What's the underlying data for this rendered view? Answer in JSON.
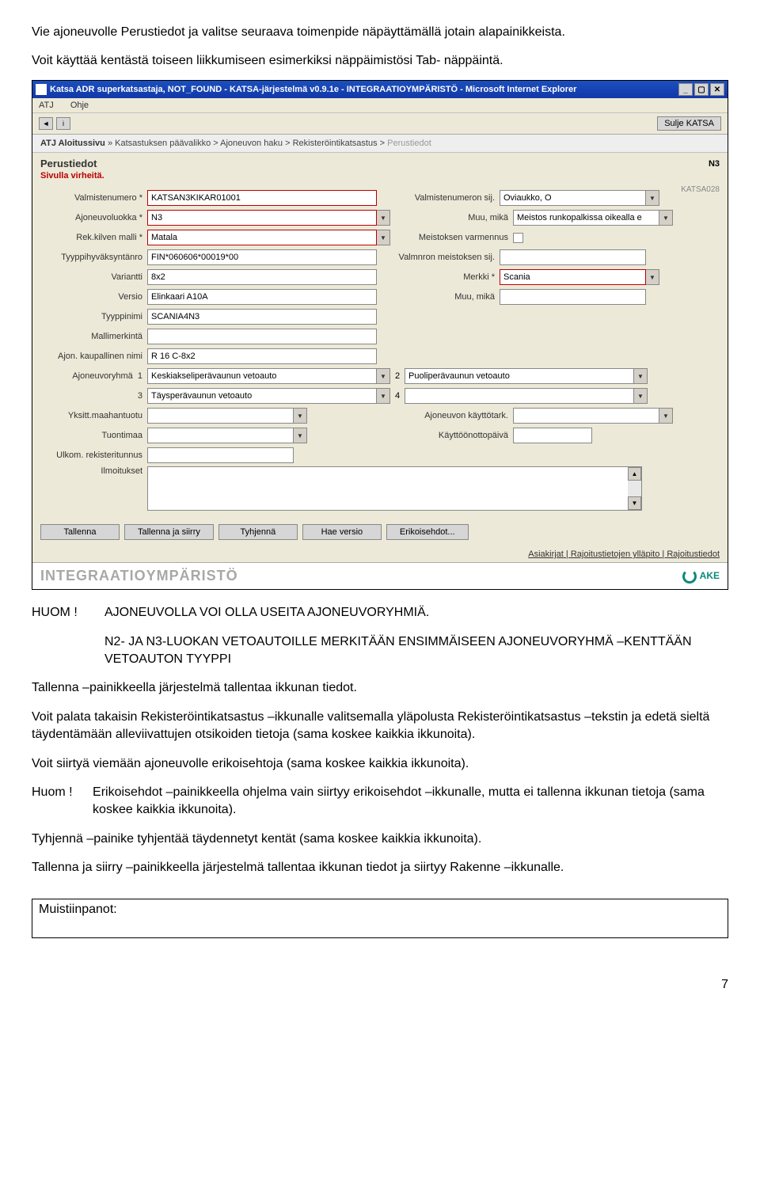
{
  "intro": {
    "p1": "Vie ajoneuvolle Perustiedot ja valitse seuraava toimenpide näpäyttämällä jotain alapainikkeista.",
    "p2": "Voit käyttää kentästä toiseen liikkumiseen esimerkiksi näppäimistösi Tab- näppäintä."
  },
  "titlebar": {
    "text": "Katsa ADR superkatsastaja, NOT_FOUND - KATSA-järjestelmä v0.9.1e - INTEGRAATIOYMPÄRISTÖ - Microsoft Internet Explorer",
    "min": "_",
    "max": "▢",
    "close": "✕"
  },
  "menubar": {
    "m1": "ATJ",
    "m2": "Ohje"
  },
  "toolbar": {
    "back": "◄",
    "fwd": "i",
    "close_katsa": "Sulje KATSA"
  },
  "breadcrumb": {
    "start": "ATJ Aloitussivu",
    "sep": " » ",
    "b1": "Katsastuksen päävalikko",
    "b2": " > Ajoneuvon haku > ",
    "b3": "Rekisteröintikatsastus",
    "b4": " > ",
    "cur": "Perustiedot"
  },
  "header": {
    "title": "Perustiedot",
    "right": "N3",
    "error": "Sivulla virheitä.",
    "pagecode": "KATSA028"
  },
  "form": {
    "l_valmnum": "Valmistenumero *",
    "v_valmnum": "KATSAN3KIKAR01001",
    "l_valmsij": "Valmistenumeron sij.",
    "v_valmsij": "Oviaukko, O",
    "l_luokka": "Ajoneuvoluokka *",
    "v_luokka": "N3",
    "l_muumika": "Muu, mikä",
    "v_muumika": "Meistos runkopalkissa oikealla e",
    "l_rekmalli": "Rek.kilven malli *",
    "v_rekmalli": "Matala",
    "l_varmennus": "Meistoksen varmennus",
    "l_tyyppihyv": "Tyyppihyväksyntänro",
    "v_tyyppihyv": "FIN*060606*00019*00",
    "l_valmsij2": "Valmnron meistoksen sij.",
    "l_variantti": "Variantti",
    "v_variantti": "8x2",
    "l_merkki": "Merkki *",
    "v_merkki": "Scania",
    "l_versio": "Versio",
    "v_versio": "Elinkaari A10A",
    "l_muumika2": "Muu, mikä",
    "l_tyyppinimi": "Tyyppinimi",
    "v_tyyppinimi": "SCANIA4N3",
    "l_mallimerk": "Mallimerkintä",
    "l_kaupnimi": "Ajon. kaupallinen nimi",
    "v_kaupnimi": "R 16 C-8x2",
    "l_ryhma": "Ajoneuvoryhmä",
    "r1n": "1",
    "r1v": "Keskiakseliperävaunun vetoauto",
    "r2n": "2",
    "r2v": "Puoliperävaunun vetoauto",
    "r3n": "3",
    "r3v": "Täysperävaunun vetoauto",
    "r4n": "4",
    "l_yksmaah": "Yksitt.maahantuotu",
    "l_kayttark": "Ajoneuvon käyttötark.",
    "l_tuontimaa": "Tuontimaa",
    "l_kayttoon": "Käyttöönottopäivä",
    "l_ulkomrek": "Ulkom. rekisteritunnus",
    "l_ilmoitukset": "Ilmoitukset"
  },
  "buttons": {
    "b1": "Tallenna",
    "b2": "Tallenna ja siirry",
    "b3": "Tyhjennä",
    "b4": "Hae versio",
    "b5": "Erikoisehdot..."
  },
  "links": {
    "l1": "Asiakirjat",
    "sep": " | ",
    "l2": "Rajoitustietojen ylläpito",
    "l3": "Rajoitustiedot"
  },
  "footerbar": {
    "env": "INTEGRAATIOYMPÄRISTÖ",
    "ake": "AKE"
  },
  "after": {
    "huom_lbl": "HUOM !",
    "huom_txt": "AJONEUVOLLA VOI OLLA USEITA AJONEUVORYHMIÄ.",
    "huom_ind": "N2- JA N3-LUOKAN VETOAUTOILLE MERKITÄÄN ENSIMMÄISEEN AJONEUVORYHMÄ –KENTTÄÄN VETOAUTON TYYPPI",
    "p1": "Tallenna –painikkeella järjestelmä tallentaa ikkunan tiedot.",
    "p2": "Voit palata takaisin Rekisteröintikatsastus –ikkunalle valitsemalla yläpolusta Rekisteröintikatsastus –tekstin ja edetä sieltä täydentämään alleviivattujen otsikoiden tietoja (sama koskee kaikkia ikkunoita).",
    "p3": "Voit siirtyä viemään ajoneuvolle erikoisehtoja (sama koskee kaikkia ikkunoita).",
    "huom2_lbl": "Huom !",
    "huom2_txt": "Erikoisehdot –painikkeella ohjelma vain siirtyy erikoisehdot –ikkunalle, mutta ei tallenna ikkunan tietoja (sama koskee kaikkia ikkunoita).",
    "p4": "Tyhjennä –painike tyhjentää täydennetyt kentät (sama koskee kaikkia ikkunoita).",
    "p5": "Tallenna ja siirry –painikkeella järjestelmä tallentaa ikkunan tiedot ja siirtyy Rakenne –ikkunalle."
  },
  "notes_lbl": "Muistiinpanot:",
  "pagenum": "7"
}
